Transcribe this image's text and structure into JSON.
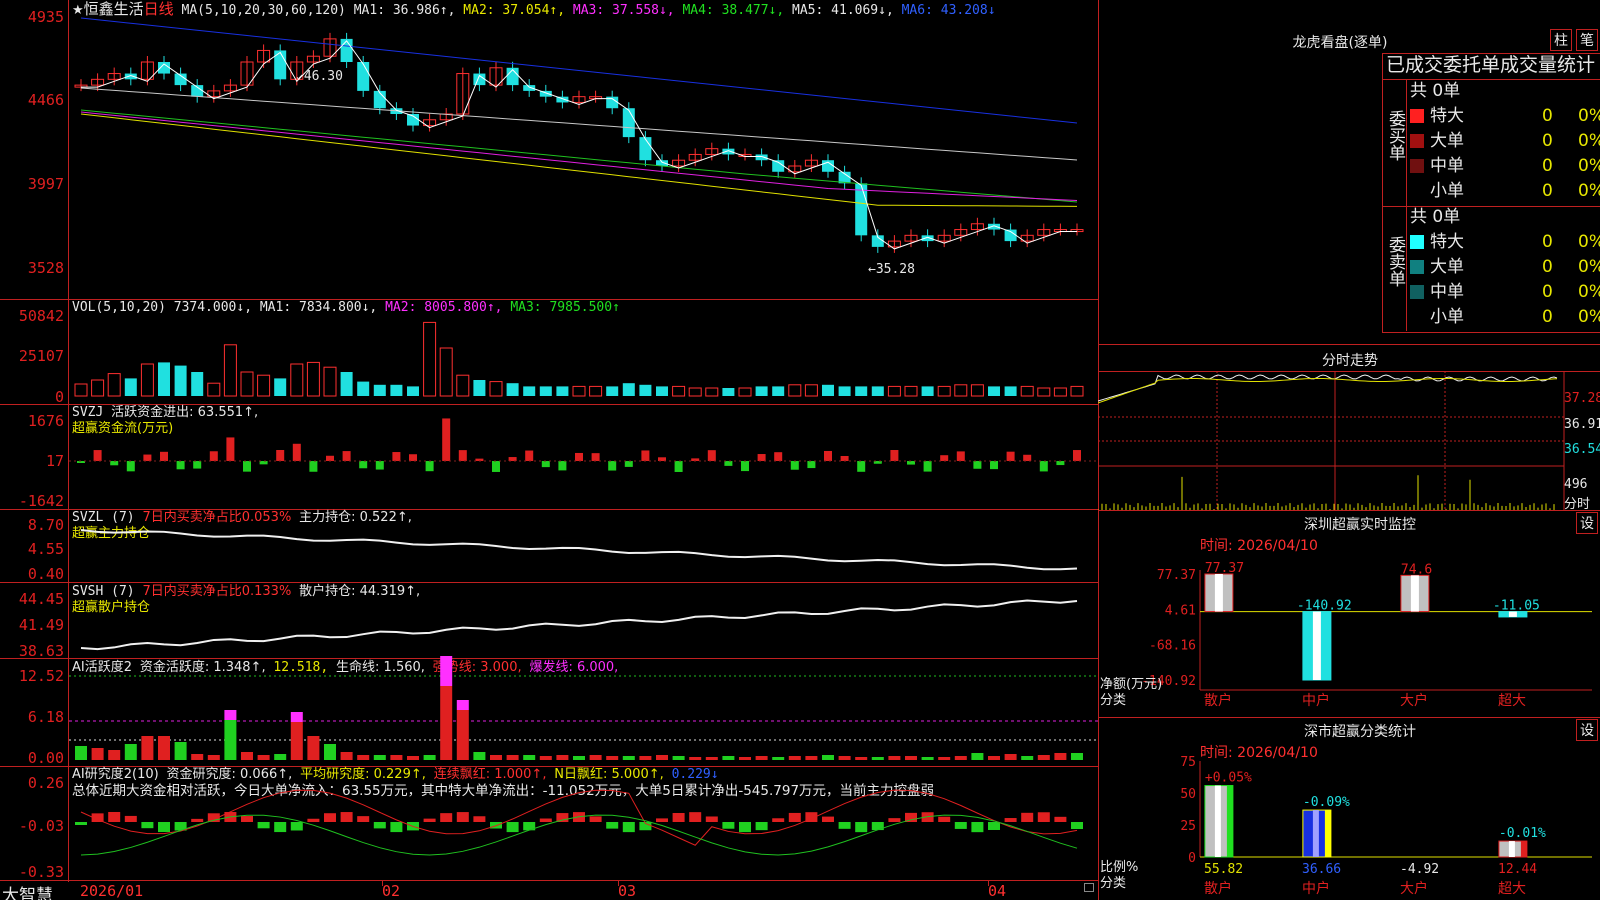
{
  "stock": {
    "star": "★",
    "name": "恒鑫生活",
    "period": "日线"
  },
  "main_chart": {
    "ma_label": "MA(5,10,20,30,60,120)",
    "ma1": "MA1: 36.986↑,",
    "ma2": "MA2: 37.054↑,",
    "ma3": "MA3: 37.558↓,",
    "ma4": "MA4: 38.477↓,",
    "ma5": "MA5: 41.069↓,",
    "ma6": "MA6: 43.208↓",
    "y_labels": [
      "4935",
      "4466",
      "3997",
      "3528"
    ],
    "high_mark": "46.30",
    "low_mark": "35.28"
  },
  "vol_panel": {
    "label": "VOL(5,10,20)",
    "value": "7374.000↓,",
    "ma1": "MA1: 7834.800↓,",
    "ma2": "MA2: 8005.800↑,",
    "ma3": "MA3: 7985.500↑",
    "y_labels": [
      "50842",
      "25107",
      "0"
    ]
  },
  "svzj_panel": {
    "label": "SVZJ",
    "text": "活跃资金进出: 63.551↑,",
    "sub": "超赢资金流(万元)",
    "y_labels": [
      "1676",
      "17",
      "-1642"
    ]
  },
  "svzl_panel": {
    "label": "SVZL (7)",
    "text1": "7日内买卖净占比0.053%",
    "text2": "主力持仓: 0.522↑,",
    "sub": "超赢主力持仓",
    "y_labels": [
      "8.70",
      "4.55",
      "0.40"
    ]
  },
  "svsh_panel": {
    "label": "SVSH (7)",
    "text1": "7日内买卖净占比0.133%",
    "text2": "散户持仓: 44.319↑,",
    "sub": "超赢散户持仓",
    "y_labels": [
      "44.45",
      "41.49",
      "38.63"
    ]
  },
  "ai_active_panel": {
    "label": "AI活跃度2",
    "t1": "资金活跃度: 1.348↑,",
    "t2": "12.518,",
    "t3": "生命线: 1.560,",
    "t4": "强势线: 3.000,",
    "t5": "爆发线: 6.000,",
    "y_labels": [
      "12.52",
      "6.18",
      "0.00"
    ]
  },
  "ai_research_panel": {
    "label": "AI研究度2(10)",
    "t1": "资金研究度: 0.066↑,",
    "t2": "平均研究度: 0.229↑,",
    "t3": "连续飘红: 1.000↑,",
    "t4": "N日飘红: 5.000↑,",
    "t5": "0.229↓",
    "summary": "总体近期大资金相对活跃，今日大单净流入：63.55万元，其中特大单净流出：-11.052万元，大单5日累计净出-545.797万元，当前主力控盘弱",
    "y_labels": [
      "0.26",
      "-0.03",
      "-0.33"
    ]
  },
  "x_axis": {
    "brand": "大智慧",
    "labels": [
      "2026/01",
      "02",
      "03",
      "04"
    ]
  },
  "order_book": {
    "title": "龙虎看盘(逐单)",
    "btn1": "柱",
    "btn2": "笔",
    "header": "已成交委托单成交量统计",
    "buy": {
      "side": "委买单",
      "count": "共 0单",
      "rows": [
        {
          "name": "特大",
          "vol": "0",
          "pct": "0%",
          "color": "#ff2020"
        },
        {
          "name": "大单",
          "vol": "0",
          "pct": "0%",
          "color": "#a01010"
        },
        {
          "name": "中单",
          "vol": "0",
          "pct": "0%",
          "color": "#701010"
        },
        {
          "name": "小单",
          "vol": "0",
          "pct": "0%",
          "color": "#000000"
        }
      ]
    },
    "sell": {
      "side": "委卖单",
      "count": "共 0单",
      "rows": [
        {
          "name": "特大",
          "vol": "0",
          "pct": "0%",
          "color": "#20ffff"
        },
        {
          "name": "大单",
          "vol": "0",
          "pct": "0%",
          "color": "#108080"
        },
        {
          "name": "中单",
          "vol": "0",
          "pct": "0%",
          "color": "#106060"
        },
        {
          "name": "小单",
          "vol": "0",
          "pct": "0%",
          "color": "#000000"
        }
      ]
    }
  },
  "intraday": {
    "title": "分时走势",
    "price_labels": [
      "37.28",
      "36.91",
      "36.54"
    ],
    "vol_labels": [
      "496",
      "分时"
    ]
  },
  "sz_monitor": {
    "title": "深圳超赢实时监控",
    "gear": "设",
    "time": "时间: 2026/04/10",
    "y_labels": [
      "77.37",
      "4.61",
      "-68.16",
      "-140.92"
    ],
    "ylabel1": "净额(万元)",
    "ylabel2": "分类",
    "categories": [
      "散户",
      "中户",
      "大户",
      "超大"
    ],
    "values": [
      77.37,
      -140.92,
      74.6,
      -11.05
    ],
    "value_labels": [
      "77.37",
      "-140.92",
      "74.6",
      "-11.05"
    ]
  },
  "sz_class": {
    "title": "深市超赢分类统计",
    "gear": "设",
    "time": "时间: 2026/04/10",
    "y_labels": [
      "75",
      "50",
      "25",
      "0"
    ],
    "ylabel1": "比例%",
    "ylabel2": "分类",
    "categories": [
      "散户",
      "中户",
      "大户",
      "超大"
    ],
    "bar_values": [
      55.82,
      36.66,
      0,
      12.44
    ],
    "top_labels": [
      "+0.05%",
      "-0.09%",
      "",
      "-0.01%"
    ],
    "bottom_labels": [
      "55.82",
      "36.66",
      "-4.92",
      "12.44"
    ]
  }
}
